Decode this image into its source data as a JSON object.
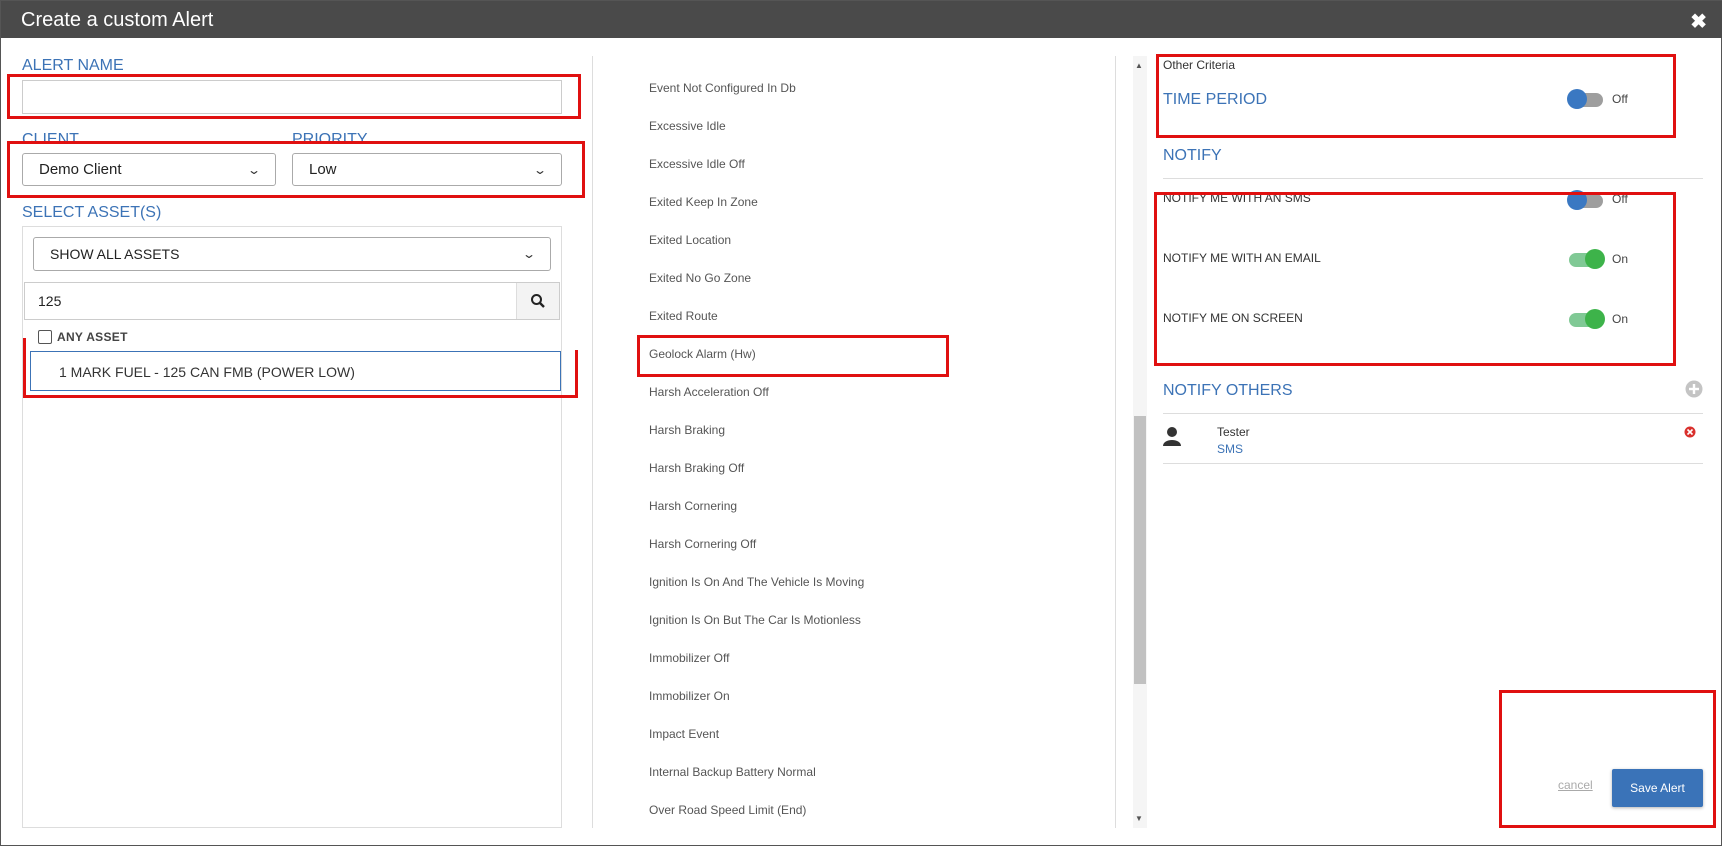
{
  "window": {
    "title": "Create a custom Alert",
    "close": "✖"
  },
  "form": {
    "alert_name_label": "ALERT NAME",
    "alert_name_value": "",
    "client_label": "CLIENT",
    "client_value": "Demo Client",
    "priority_label": "PRIORITY",
    "priority_value": "Low",
    "select_assets_label": "SELECT ASSET(S)",
    "assets_filter": "SHOW ALL ASSETS",
    "search_value": "125",
    "any_asset_label": "ANY ASSET",
    "asset_item": "1 MARK FUEL - 125 CAN FMB (POWER LOW)"
  },
  "events": [
    "Event Not Configured In Db",
    "Excessive Idle",
    "Excessive Idle Off",
    "Exited Keep In Zone",
    "Exited Location",
    "Exited No Go Zone",
    "Exited Route",
    "Geolock Alarm (Hw)",
    "Harsh Acceleration Off",
    "Harsh Braking",
    "Harsh Braking Off",
    "Harsh Cornering",
    "Harsh Cornering Off",
    "Ignition Is On And The Vehicle Is Moving",
    "Ignition Is On But The Car Is Motionless",
    "Immobilizer Off",
    "Immobilizer On",
    "Impact Event",
    "Internal Backup Battery Normal",
    "Over Road Speed Limit (End)"
  ],
  "criteria": {
    "other_criteria": "Other Criteria",
    "time_period_label": "TIME PERIOD",
    "time_period_state": "Off"
  },
  "notify": {
    "title": "NOTIFY",
    "sms_label": "NOTIFY ME WITH AN SMS",
    "sms_state": "Off",
    "email_label": "NOTIFY ME WITH AN EMAIL",
    "email_state": "On",
    "screen_label": "NOTIFY ME ON SCREEN",
    "screen_state": "On"
  },
  "notify_others": {
    "title": "NOTIFY OTHERS",
    "person_name": "Tester",
    "person_method": "SMS"
  },
  "actions": {
    "cancel": "cancel",
    "save": "Save Alert"
  },
  "colors": {
    "accent": "#3c73b6",
    "highlight": "#e01010",
    "toggle_on": "#3db34a",
    "toggle_off_knob": "#3a78c2"
  }
}
